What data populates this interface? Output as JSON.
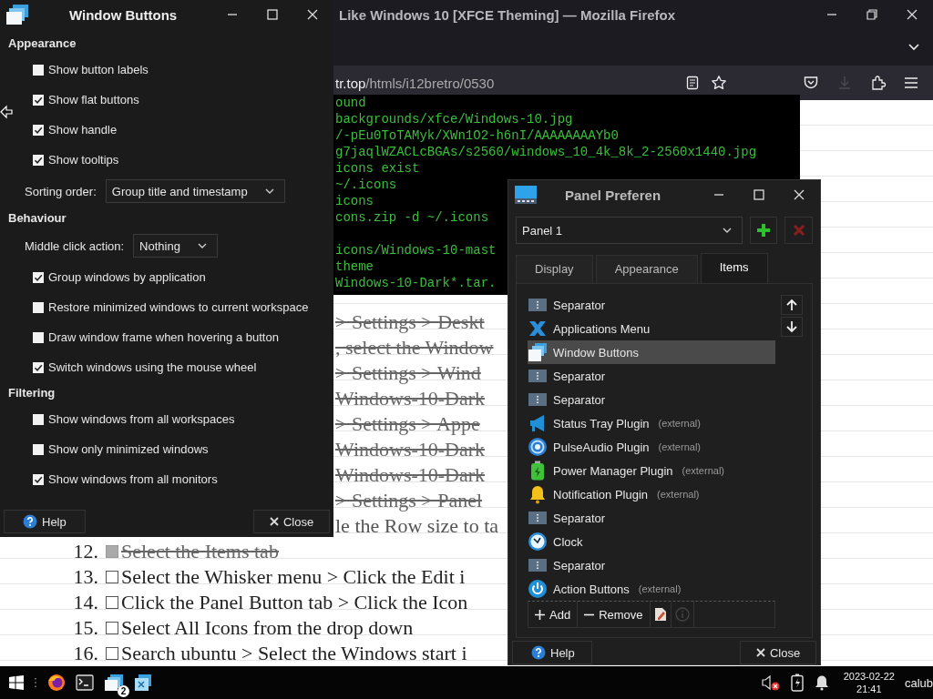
{
  "browser": {
    "title": "Like Windows 10 [XFCE Theming] — Mozilla Firefox",
    "url_host": "tr.top",
    "url_path": "/htmls/i12bretro/0530",
    "terminal_blocks": [
      [
        "ound",
        "backgrounds/xfce/Windows-10.jpg",
        "/-pEu0ToTAMyk/XWn1O2-h6nI/AAAAAAAAYb0",
        "g7jaqlWZACLcBGAs/s2560/windows_10_4k_8k_2-2560x1440.jpg",
        "icons exist",
        "~/.icons",
        "icons",
        "cons.zip -d ~/.icons"
      ],
      [
        "icons/Windows-10-mast",
        "theme",
        "Windows-10-Dark*.tar."
      ]
    ],
    "steps": [
      {
        "text": "> Settings > Deskt",
        "done": true
      },
      {
        "text": ", select the Window",
        "done": true
      },
      {
        "text": "> Settings > Wind",
        "done": true
      },
      {
        "text": "Windows-10-Dark",
        "done": true
      },
      {
        "text": "> Settings > Appe",
        "done": true
      },
      {
        "text": "Windows-10-Dark",
        "done": true
      },
      {
        "text": "Windows-10-Dark",
        "done": true
      },
      {
        "text": "> Settings > Panel",
        "done": true
      },
      {
        "text": "le the Row size to ta",
        "done": false
      },
      {
        "number": "12.",
        "text": "Select the Items tab",
        "done": true,
        "checked": true
      },
      {
        "number": "13.",
        "text": "Select the Whisker menu > Click the Edit i",
        "done": false,
        "checked": false
      },
      {
        "number": "14.",
        "text": "Click the Panel Button tab > Click the Icon",
        "done": false,
        "checked": false
      },
      {
        "number": "15.",
        "text": "Select All Icons from the drop down",
        "done": false,
        "checked": false
      },
      {
        "number": "16.",
        "text": "Search ubuntu > Select the Windows start i",
        "done": false,
        "checked": false
      }
    ]
  },
  "window_buttons": {
    "title": "Window Buttons",
    "sections": [
      {
        "heading": "Appearance",
        "rows": [
          {
            "kind": "checkbox",
            "label": "Show button labels",
            "checked": false
          },
          {
            "kind": "checkbox",
            "label": "Show flat buttons",
            "checked": true
          },
          {
            "kind": "checkbox",
            "label": "Show handle",
            "checked": true
          },
          {
            "kind": "checkbox",
            "label": "Show tooltips",
            "checked": true
          },
          {
            "kind": "dropdown",
            "label": "Sorting order:",
            "value": "Group title and timestamp"
          }
        ]
      },
      {
        "heading": "Behaviour",
        "rows": [
          {
            "kind": "dropdown",
            "label": "Middle click action:",
            "value": "Nothing"
          },
          {
            "kind": "checkbox",
            "label": "Group windows by application",
            "checked": true
          },
          {
            "kind": "checkbox",
            "label": "Restore minimized windows to current workspace",
            "checked": false
          },
          {
            "kind": "checkbox",
            "label": "Draw window frame when hovering a button",
            "checked": false
          },
          {
            "kind": "checkbox",
            "label": "Switch windows using the mouse wheel",
            "checked": true
          }
        ]
      },
      {
        "heading": "Filtering",
        "rows": [
          {
            "kind": "checkbox",
            "label": "Show windows from all workspaces",
            "checked": false
          },
          {
            "kind": "checkbox",
            "label": "Show only minimized windows",
            "checked": false
          },
          {
            "kind": "checkbox",
            "label": "Show windows from all monitors",
            "checked": true
          }
        ]
      }
    ],
    "help": "Help",
    "close": "Close"
  },
  "panel_preferences": {
    "title": "Panel Preferen",
    "panel": "Panel 1",
    "tabs": [
      {
        "label": "Display",
        "selected": false
      },
      {
        "label": "Appearance",
        "selected": false
      },
      {
        "label": "Items",
        "selected": true
      }
    ],
    "items": [
      {
        "kind": "separator",
        "name": "Separator",
        "selected": false
      },
      {
        "kind": "appmenu",
        "name": "Applications Menu",
        "selected": false
      },
      {
        "kind": "windows",
        "name": "Window Buttons",
        "selected": true
      },
      {
        "kind": "separator",
        "name": "Separator",
        "selected": false
      },
      {
        "kind": "separator",
        "name": "Separator",
        "selected": false
      },
      {
        "kind": "tray",
        "name": "Status Tray Plugin",
        "note": "(external)",
        "selected": false
      },
      {
        "kind": "audio",
        "name": "PulseAudio Plugin",
        "note": "(external)",
        "selected": false
      },
      {
        "kind": "power",
        "name": "Power Manager Plugin",
        "note": "(external)",
        "selected": false
      },
      {
        "kind": "bell",
        "name": "Notification Plugin",
        "note": "(external)",
        "selected": false
      },
      {
        "kind": "separator",
        "name": "Separator",
        "selected": false
      },
      {
        "kind": "clock",
        "name": "Clock",
        "selected": false
      },
      {
        "kind": "separator",
        "name": "Separator",
        "selected": false
      },
      {
        "kind": "action",
        "name": "Action Buttons",
        "note": "(external)",
        "selected": false
      }
    ],
    "add": "Add",
    "remove": "Remove",
    "help": "Help",
    "close": "Close"
  },
  "taskbar": {
    "badge": "2",
    "date": "2023-02-22",
    "time": "21:41",
    "user": "calub"
  }
}
